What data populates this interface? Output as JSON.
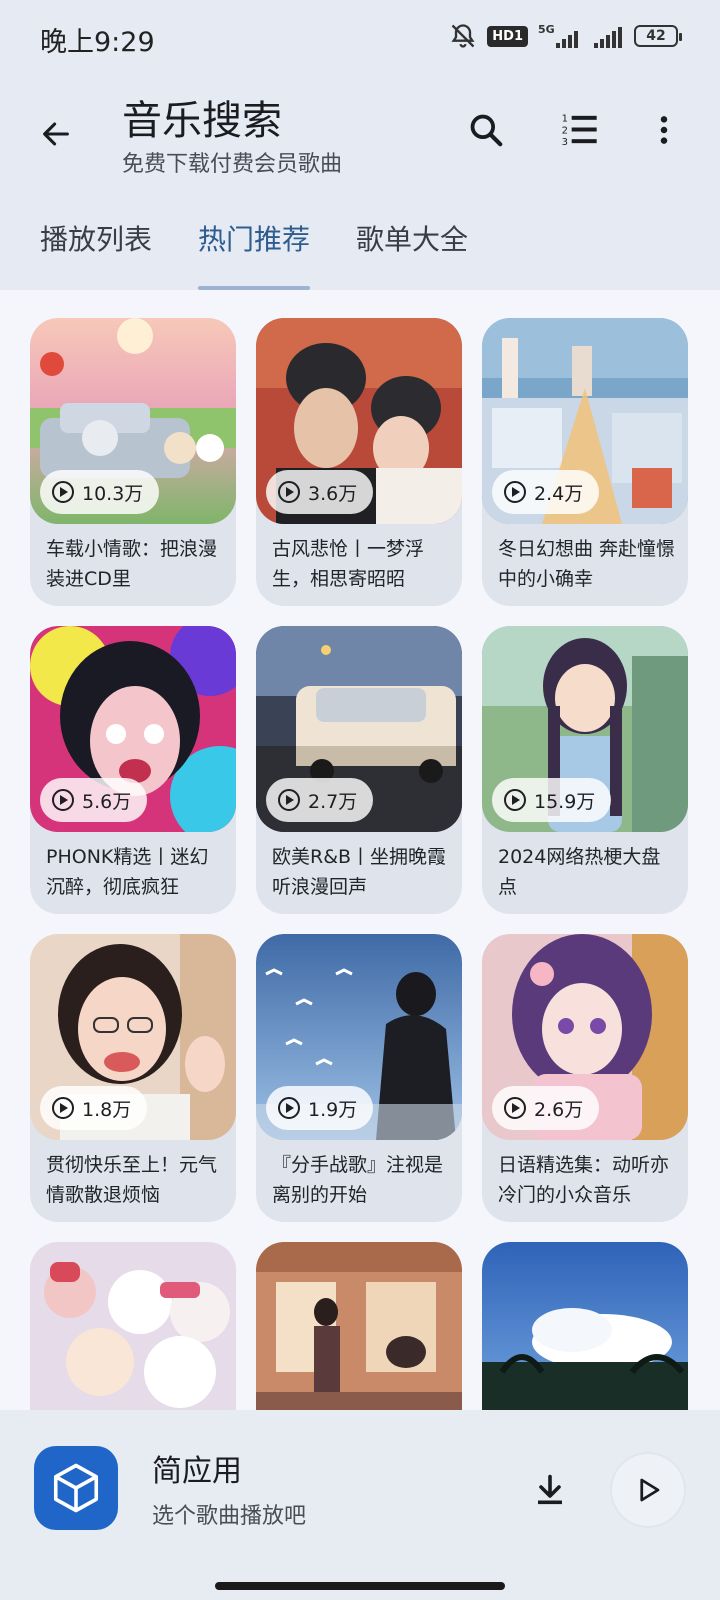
{
  "status_bar": {
    "time": "晚上9:29",
    "network": "5G",
    "hd_label": "HD1",
    "battery": "42"
  },
  "app_bar": {
    "title": "音乐搜索",
    "subtitle": "免费下载付费会员歌曲",
    "icons": [
      "back-arrow-icon",
      "search-icon",
      "playlist-order-icon",
      "more-vert-icon"
    ]
  },
  "tabs": [
    {
      "label": "播放列表",
      "active": false
    },
    {
      "label": "热门推荐",
      "active": true
    },
    {
      "label": "歌单大全",
      "active": false
    }
  ],
  "playlists": [
    {
      "count": "10.3万",
      "title": "车载小情歌：把浪漫装进CD里"
    },
    {
      "count": "3.6万",
      "title": "古风悲怆丨一梦浮生，相思寄昭昭"
    },
    {
      "count": "2.4万",
      "title": "冬日幻想曲 奔赴憧憬中的小确幸"
    },
    {
      "count": "5.6万",
      "title": "PHONK精选丨迷幻沉醉，彻底疯狂"
    },
    {
      "count": "2.7万",
      "title": "欧美R&B丨坐拥晚霞听浪漫回声"
    },
    {
      "count": "15.9万",
      "title": "2024网络热梗大盘点"
    },
    {
      "count": "1.8万",
      "title": "贯彻快乐至上！元气情歌散退烦恼"
    },
    {
      "count": "1.9万",
      "title": "『分手战歌』注视是离别的开始"
    },
    {
      "count": "2.6万",
      "title": "日语精选集：动听亦冷门的小众音乐"
    },
    {
      "count": "",
      "title": ""
    },
    {
      "count": "",
      "title": ""
    },
    {
      "count": "",
      "title": ""
    }
  ],
  "player": {
    "title": "简应用",
    "subtitle": "选个歌曲播放吧"
  },
  "colors": {
    "accent": "#2f5c8f",
    "surface": "#e6ebf3",
    "card": "#dfe4ec",
    "logo": "#1f66c8"
  }
}
